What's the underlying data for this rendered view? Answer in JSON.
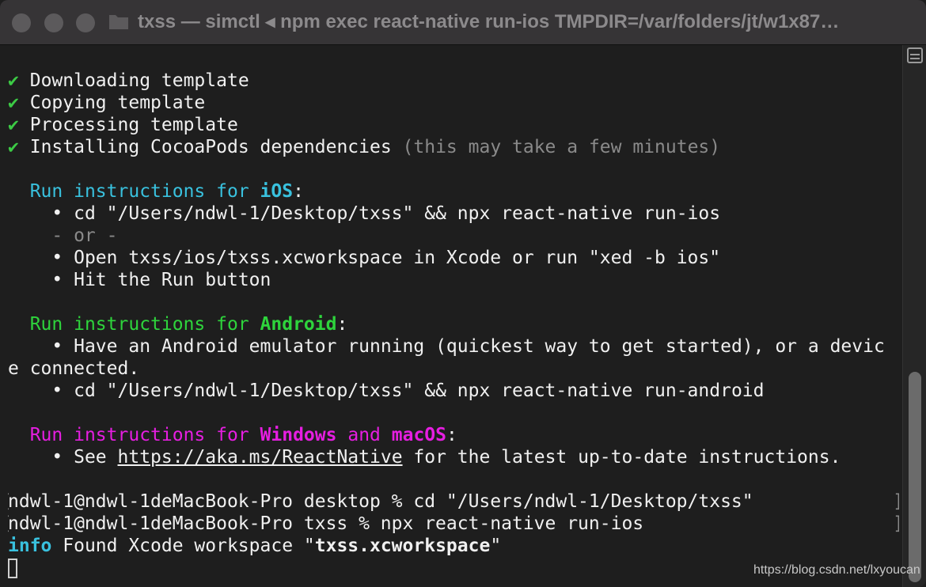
{
  "window": {
    "title": "txss — simctl ◂ npm exec react-native run-ios TMPDIR=/var/folders/jt/w1x87…",
    "folder_icon": "folder-icon",
    "traffic_lights": [
      "close-button",
      "minimize-button",
      "zoom-button"
    ]
  },
  "terminal": {
    "check": "✔",
    "steps": [
      "Downloading template",
      "Copying template",
      "Processing template",
      "Installing CocoaPods dependencies"
    ],
    "steps_note": "(this may take a few minutes)",
    "ios": {
      "run": "Run",
      "instructions": "instructions",
      "for": "for",
      "platform": "iOS",
      "colon": ":",
      "bullet1": "cd \"/Users/ndwl-1/Desktop/txss\" && npx react-native run-ios",
      "or": "- or -",
      "bullet2": "Open txss/ios/txss.xcworkspace in Xcode or run \"xed -b ios\"",
      "bullet3": "Hit the Run button"
    },
    "android": {
      "run": "Run",
      "instructions": "instructions",
      "for": "for",
      "platform": "Android",
      "colon": ":",
      "bullet1_a": "Have an Android emulator running (quickest way to get started), or a devic",
      "bullet1_b": "e connected.",
      "bullet2": "cd \"/Users/ndwl-1/Desktop/txss\" && npx react-native run-android"
    },
    "windows": {
      "run": "Run",
      "instructions": "instructions",
      "for": "for",
      "platform1": "Windows",
      "and": "and",
      "platform2": "macOS",
      "colon": ":",
      "see": "See",
      "link": "https://aka.ms/ReactNative",
      "rest": "for the latest up-to-date instructions."
    },
    "prompt1": "ndwl-1@ndwl-1deMacBook-Pro desktop % cd \"/Users/ndwl-1/Desktop/txss\"",
    "prompt2": "ndwl-1@ndwl-1deMacBook-Pro txss % npx react-native run-ios",
    "info_label": "info",
    "info_text_a": "Found Xcode workspace \"",
    "info_file": "txss.xcworkspace",
    "info_text_b": "\"",
    "bullet": "•"
  },
  "watermark": "https://blog.csdn.net/lxyoucan",
  "colors": {
    "check": "#3ccb45",
    "ios": "#39c1de",
    "android": "#2ed43c",
    "windows": "#e61ee1",
    "background": "#1e1e1e"
  }
}
